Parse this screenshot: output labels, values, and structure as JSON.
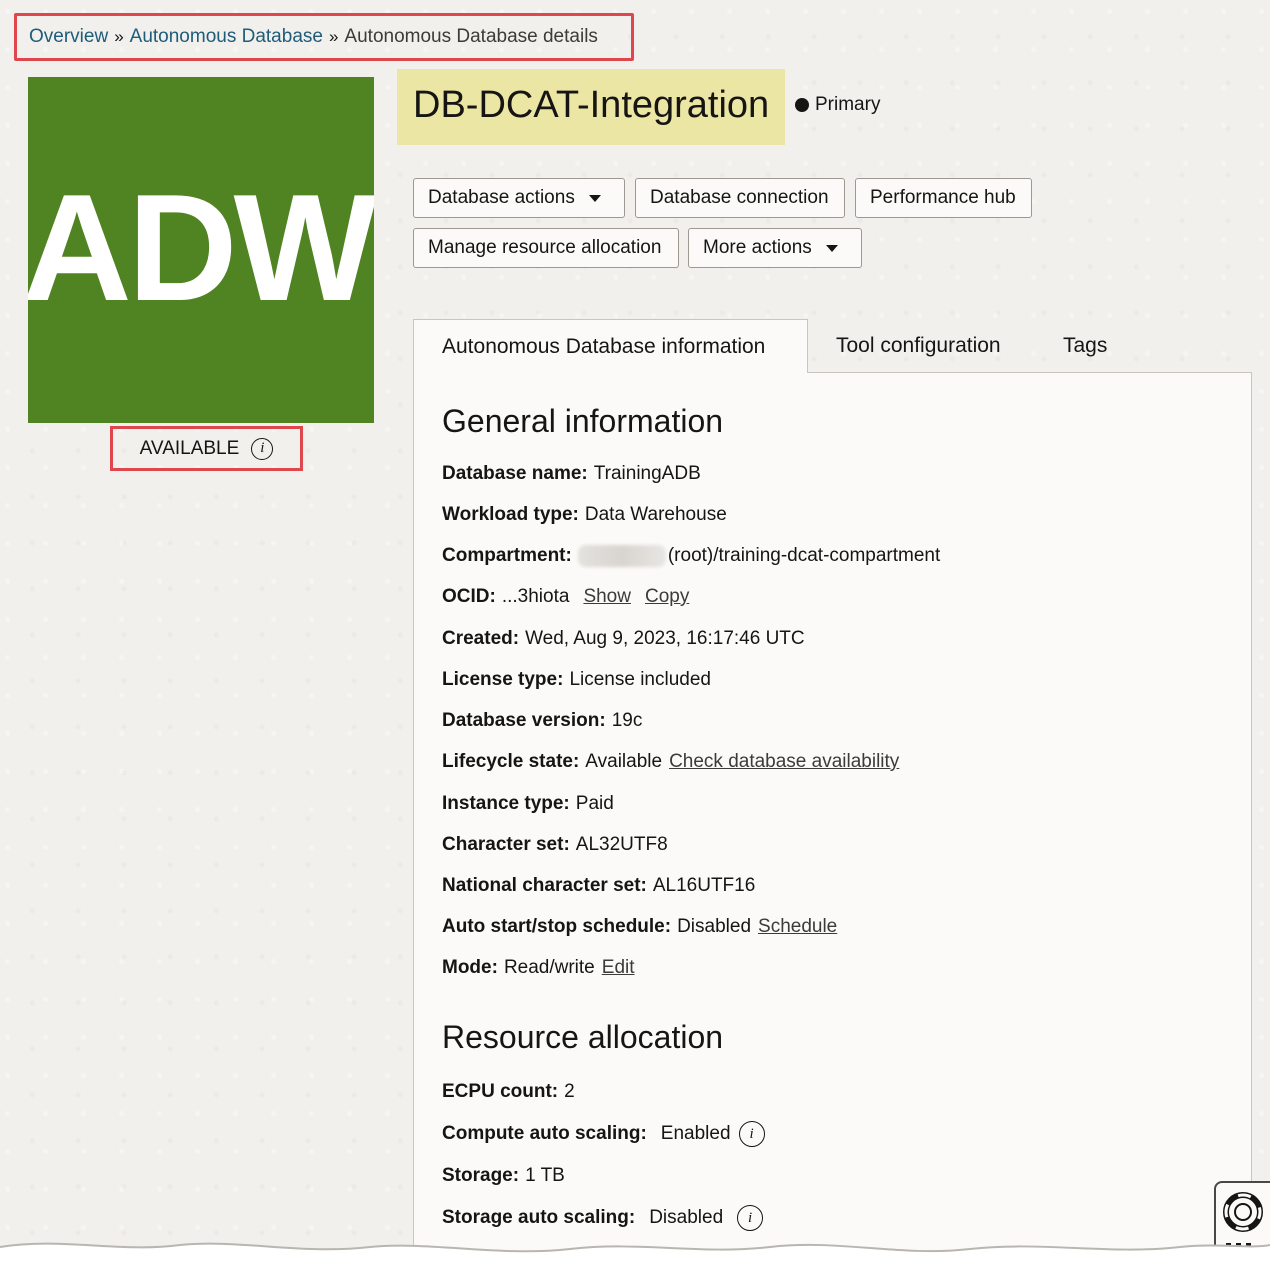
{
  "breadcrumb": {
    "items": [
      "Overview",
      "Autonomous Database"
    ],
    "separator": "»",
    "current": "Autonomous Database details"
  },
  "logo": {
    "text": "ADW",
    "color": "#508423"
  },
  "status": {
    "label": "AVAILABLE"
  },
  "header": {
    "title": "DB-DCAT-Integration",
    "role": "Primary"
  },
  "actions": {
    "database_actions": "Database actions",
    "database_connection": "Database connection",
    "performance_hub": "Performance hub",
    "manage_resource_allocation": "Manage resource allocation",
    "more_actions": "More actions"
  },
  "tabs": [
    {
      "label": "Autonomous Database information",
      "active": true
    },
    {
      "label": "Tool configuration",
      "active": false
    },
    {
      "label": "Tags",
      "active": false
    }
  ],
  "general": {
    "title": "General information",
    "database_name": {
      "label": "Database name:",
      "value": "TrainingADB"
    },
    "workload_type": {
      "label": "Workload type:",
      "value": "Data Warehouse"
    },
    "compartment": {
      "label": "Compartment:",
      "value": "(root)/training-dcat-compartment"
    },
    "ocid": {
      "label": "OCID:",
      "value": "...3hiota",
      "show": "Show",
      "copy": "Copy"
    },
    "created": {
      "label": "Created:",
      "value": "Wed, Aug 9, 2023, 16:17:46 UTC"
    },
    "license_type": {
      "label": "License type:",
      "value": "License included"
    },
    "database_version": {
      "label": "Database version:",
      "value": "19c"
    },
    "lifecycle_state": {
      "label": "Lifecycle state:",
      "value": "Available",
      "link": "Check database availability"
    },
    "instance_type": {
      "label": "Instance type:",
      "value": "Paid"
    },
    "character_set": {
      "label": "Character set:",
      "value": "AL32UTF8"
    },
    "national_character_set": {
      "label": "National character set:",
      "value": "AL16UTF16"
    },
    "auto_start_stop": {
      "label": "Auto start/stop schedule:",
      "value": "Disabled",
      "link": "Schedule"
    },
    "mode": {
      "label": "Mode:",
      "value": "Read/write",
      "link": "Edit"
    }
  },
  "resources": {
    "title": "Resource allocation",
    "ecpu_count": {
      "label": "ECPU count:",
      "value": "2"
    },
    "compute_auto_scaling": {
      "label": "Compute auto scaling:",
      "value": "Enabled"
    },
    "storage": {
      "label": "Storage:",
      "value": "1 TB"
    },
    "storage_auto_scaling": {
      "label": "Storage auto scaling:",
      "value": "Disabled"
    }
  },
  "colors": {
    "link": "#1f5c7a",
    "highlight_border": "#e0474c",
    "title_highlight": "#ece6a5",
    "logo_green": "#508423"
  },
  "icons": {
    "info": "info-circle-icon",
    "help": "life-ring-icon",
    "apps": "grid-dots-icon"
  }
}
